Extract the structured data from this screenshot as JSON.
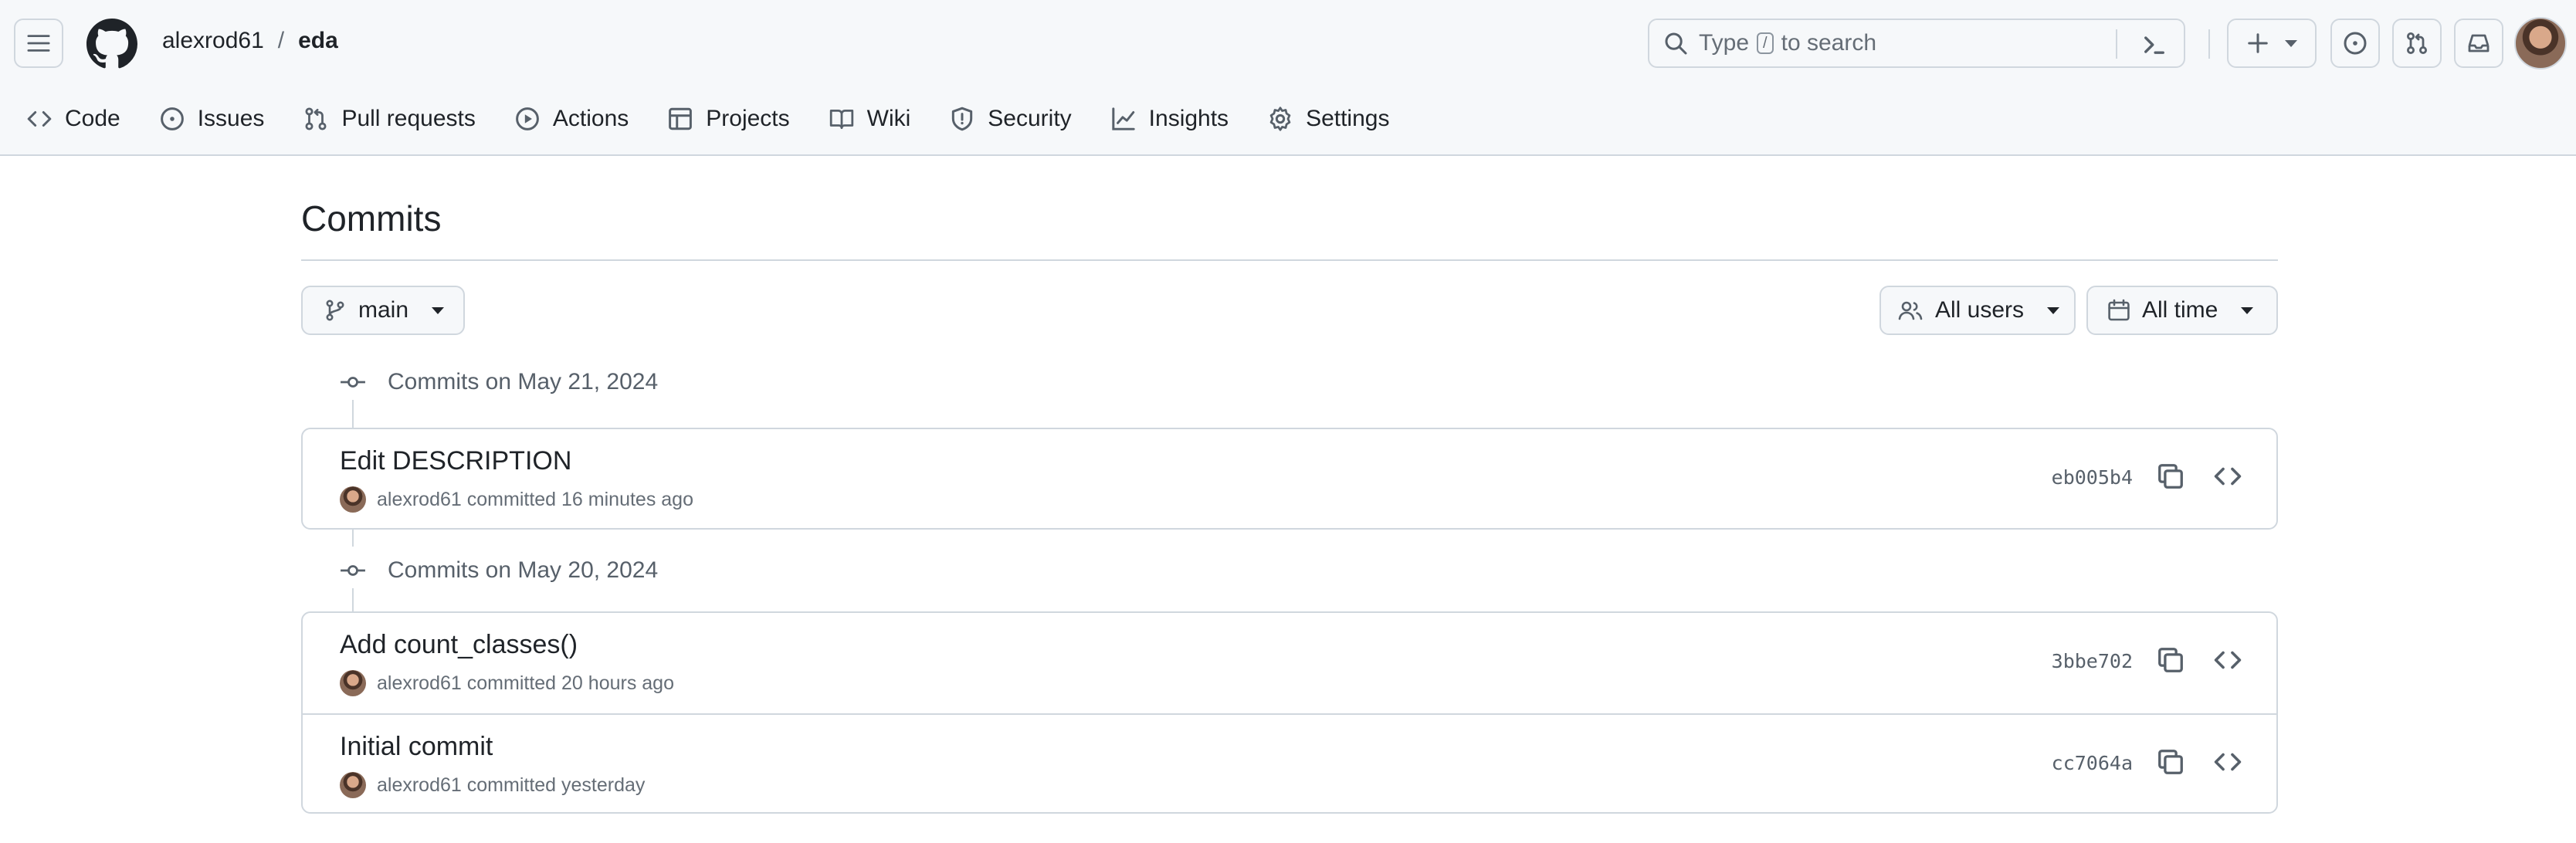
{
  "header": {
    "owner": "alexrod61",
    "separator": "/",
    "repo": "eda",
    "search": {
      "prefix": "Type",
      "key": "/",
      "suffix": "to search"
    }
  },
  "nav": {
    "tabs": [
      {
        "label": "Code",
        "icon": "code-icon"
      },
      {
        "label": "Issues",
        "icon": "issue-icon"
      },
      {
        "label": "Pull requests",
        "icon": "pull-request-icon"
      },
      {
        "label": "Actions",
        "icon": "play-icon"
      },
      {
        "label": "Projects",
        "icon": "table-icon"
      },
      {
        "label": "Wiki",
        "icon": "book-icon"
      },
      {
        "label": "Security",
        "icon": "shield-icon"
      },
      {
        "label": "Insights",
        "icon": "graph-icon"
      },
      {
        "label": "Settings",
        "icon": "gear-icon"
      }
    ]
  },
  "page": {
    "title": "Commits",
    "branch": "main",
    "users_filter": "All users",
    "time_filter": "All time"
  },
  "groups": [
    {
      "heading": "Commits on May 21, 2024",
      "commits": [
        {
          "message": "Edit DESCRIPTION",
          "author": "alexrod61",
          "action": "committed",
          "when": "16 minutes ago",
          "sha": "eb005b4"
        }
      ]
    },
    {
      "heading": "Commits on May 20, 2024",
      "commits": [
        {
          "message": "Add count_classes()",
          "author": "alexrod61",
          "action": "committed",
          "when": "20 hours ago",
          "sha": "3bbe702"
        },
        {
          "message": "Initial commit",
          "author": "alexrod61",
          "action": "committed",
          "when": "yesterday",
          "sha": "cc7064a"
        }
      ]
    }
  ],
  "colors": {
    "border": "#d0d7de",
    "muted": "#656d76",
    "text": "#1f2328",
    "header_bg": "#f6f8fa"
  }
}
